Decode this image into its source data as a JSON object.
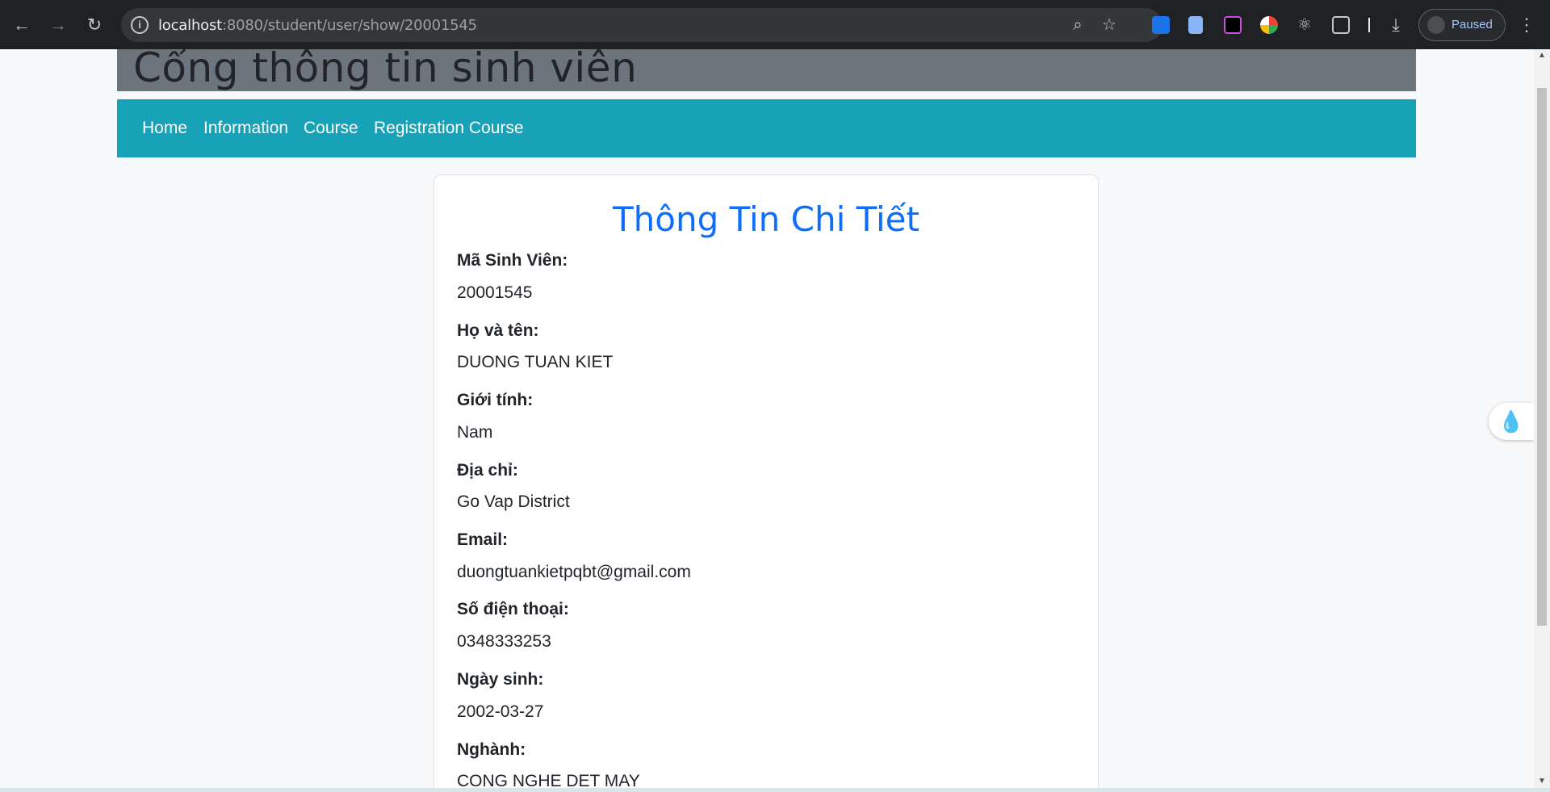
{
  "browser": {
    "url_host": "localhost",
    "url_path": ":8080/student/user/show/20001545",
    "profile_status": "Paused",
    "icons": [
      "back-icon",
      "forward-icon",
      "reload-icon",
      "site-info-icon",
      "zoom-icon",
      "bookmark-star-icon",
      "extensions-icon",
      "download-icon",
      "menu-icon"
    ]
  },
  "site": {
    "title": "Cổng thông tin sinh viên",
    "nav": [
      "Home",
      "Information",
      "Course",
      "Registration Course"
    ]
  },
  "card": {
    "title": "Thông Tin Chi Tiết",
    "fields": [
      {
        "label": "Mã Sinh Viên:",
        "value": "20001545"
      },
      {
        "label": "Họ và tên:",
        "value": "DUONG TUAN KIET"
      },
      {
        "label": "Giới tính:",
        "value": "Nam"
      },
      {
        "label": "Địa chỉ:",
        "value": "Go Vap District"
      },
      {
        "label": "Email:",
        "value": "duongtuankietpqbt@gmail.com"
      },
      {
        "label": "Số điện thoại:",
        "value": "0348333253"
      },
      {
        "label": "Ngày sinh:",
        "value": "2002-03-27"
      },
      {
        "label": "Nghành:",
        "value": "CONG NGHE DET MAY"
      }
    ]
  },
  "colors": {
    "navbar": "#17a2b8",
    "title_bar": "#6c757d",
    "card_title": "#0d6efd"
  }
}
